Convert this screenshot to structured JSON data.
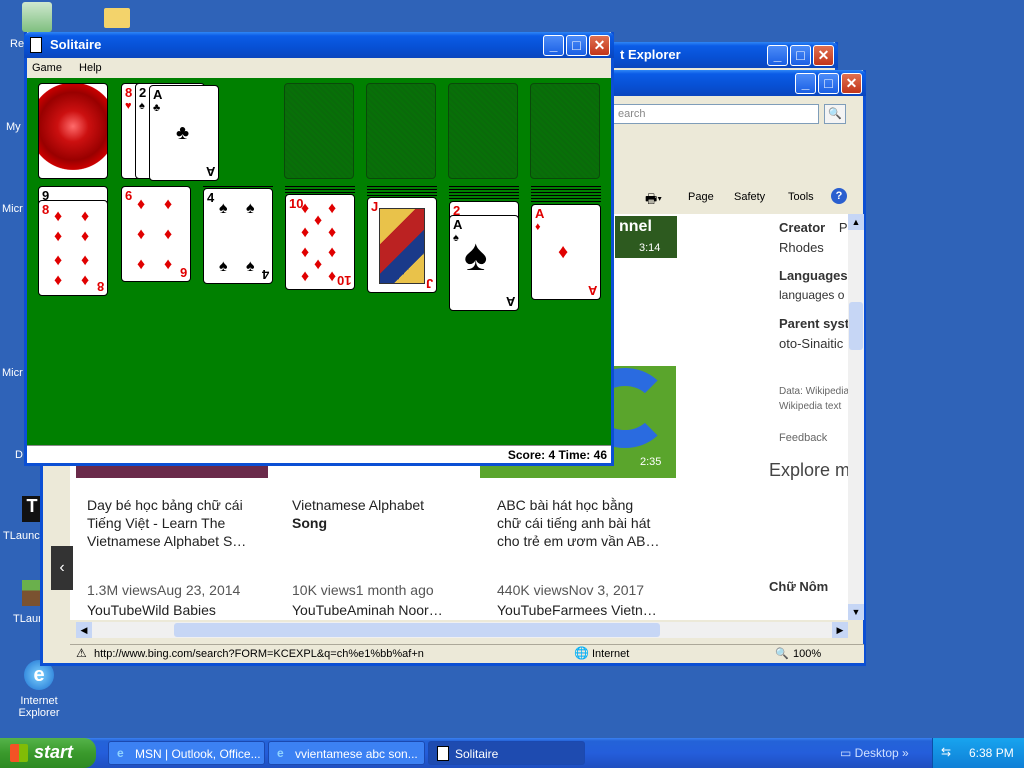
{
  "desktop": {
    "icons": [
      {
        "label": "Re"
      },
      {
        "label": "My"
      },
      {
        "label": "Micr"
      },
      {
        "label": "Micr"
      },
      {
        "label": "D"
      },
      {
        "label": "TLaunch"
      },
      {
        "label": "TLaunc"
      },
      {
        "label": "Internet Explorer"
      }
    ]
  },
  "ie_back": {
    "title": "t Explorer"
  },
  "ie_front": {
    "search_placeholder": "earch",
    "toolbar": {
      "page": "Page",
      "safety": "Safety",
      "tools": "Tools"
    },
    "videos": [
      {
        "title_line1": "Day bé học bảng chữ cái",
        "title_line2": "Tiếng Việt - Learn The",
        "title_line3": "Vietnamese Alphabet S…",
        "meta": "1.3M viewsAug 23, 2014",
        "source": "YouTubeWild Babies"
      },
      {
        "title_line1": "Vietnamese Alphabet",
        "title_line2": "Song",
        "title_line3": "",
        "meta": "10K views1 month ago",
        "source": "YouTubeAminah Noor…"
      },
      {
        "title_line1": "ABC bài hát học bằng",
        "title_line2": "chữ cái tiếng anh bài hát",
        "title_line3": "cho trẻ em ươm vần AB…",
        "meta": "440K viewsNov 3, 2017",
        "source": "YouTubeFarmees Vietn…"
      }
    ],
    "thumb_times": [
      "3:14",
      "2:35"
    ],
    "thumb_caption": "nnel",
    "side": {
      "creator_label": "Creator",
      "creator_extra": "P",
      "creator_value": "Rhodes",
      "languages_label": "Languages",
      "languages_value": "languages o",
      "parent_label": "Parent syst",
      "parent_value": "oto-Sinaitic",
      "data_line1": "Data: Wikipedia",
      "data_line2": "Wikipedia text",
      "feedback": "Feedback",
      "explore": "Explore m",
      "chu_nom": "Chữ Nôm"
    },
    "status_url": "http://www.bing.com/search?FORM=KCEXPL&q=ch%e1%bb%af+n",
    "status_zone": "Internet",
    "zoom": "100%"
  },
  "solitaire": {
    "title": "Solitaire",
    "menu": [
      "Game",
      "Help"
    ],
    "score_time": "Score: 4 Time: 46",
    "waste": [
      {
        "rank": "8",
        "suit": "♥",
        "color": "red"
      },
      {
        "rank": "2",
        "suit": "♠",
        "color": "blk"
      },
      {
        "rank": "A",
        "suit": "♣",
        "color": "blk"
      }
    ],
    "tableau": [
      {
        "hidden_rank": "9",
        "rank": "8",
        "suit": "♦",
        "color": "red"
      },
      {
        "rank": "6",
        "suit": "♦",
        "color": "red"
      },
      {
        "rank": "4",
        "suit": "♠",
        "color": "blk"
      },
      {
        "rank": "10",
        "suit": "♦",
        "color": "red"
      },
      {
        "rank": "J",
        "suit": "♦",
        "color": "red"
      },
      {
        "prev_rank": "2",
        "rank": "A",
        "suit": "♠",
        "color": "blk"
      },
      {
        "rank": "A",
        "suit": "♦",
        "color": "red"
      }
    ]
  },
  "taskbar": {
    "start": "start",
    "tasks": [
      "MSN | Outlook, Office...",
      "vvientamese abc son...",
      "Solitaire"
    ],
    "desktop": "Desktop",
    "clock": "6:38 PM"
  }
}
